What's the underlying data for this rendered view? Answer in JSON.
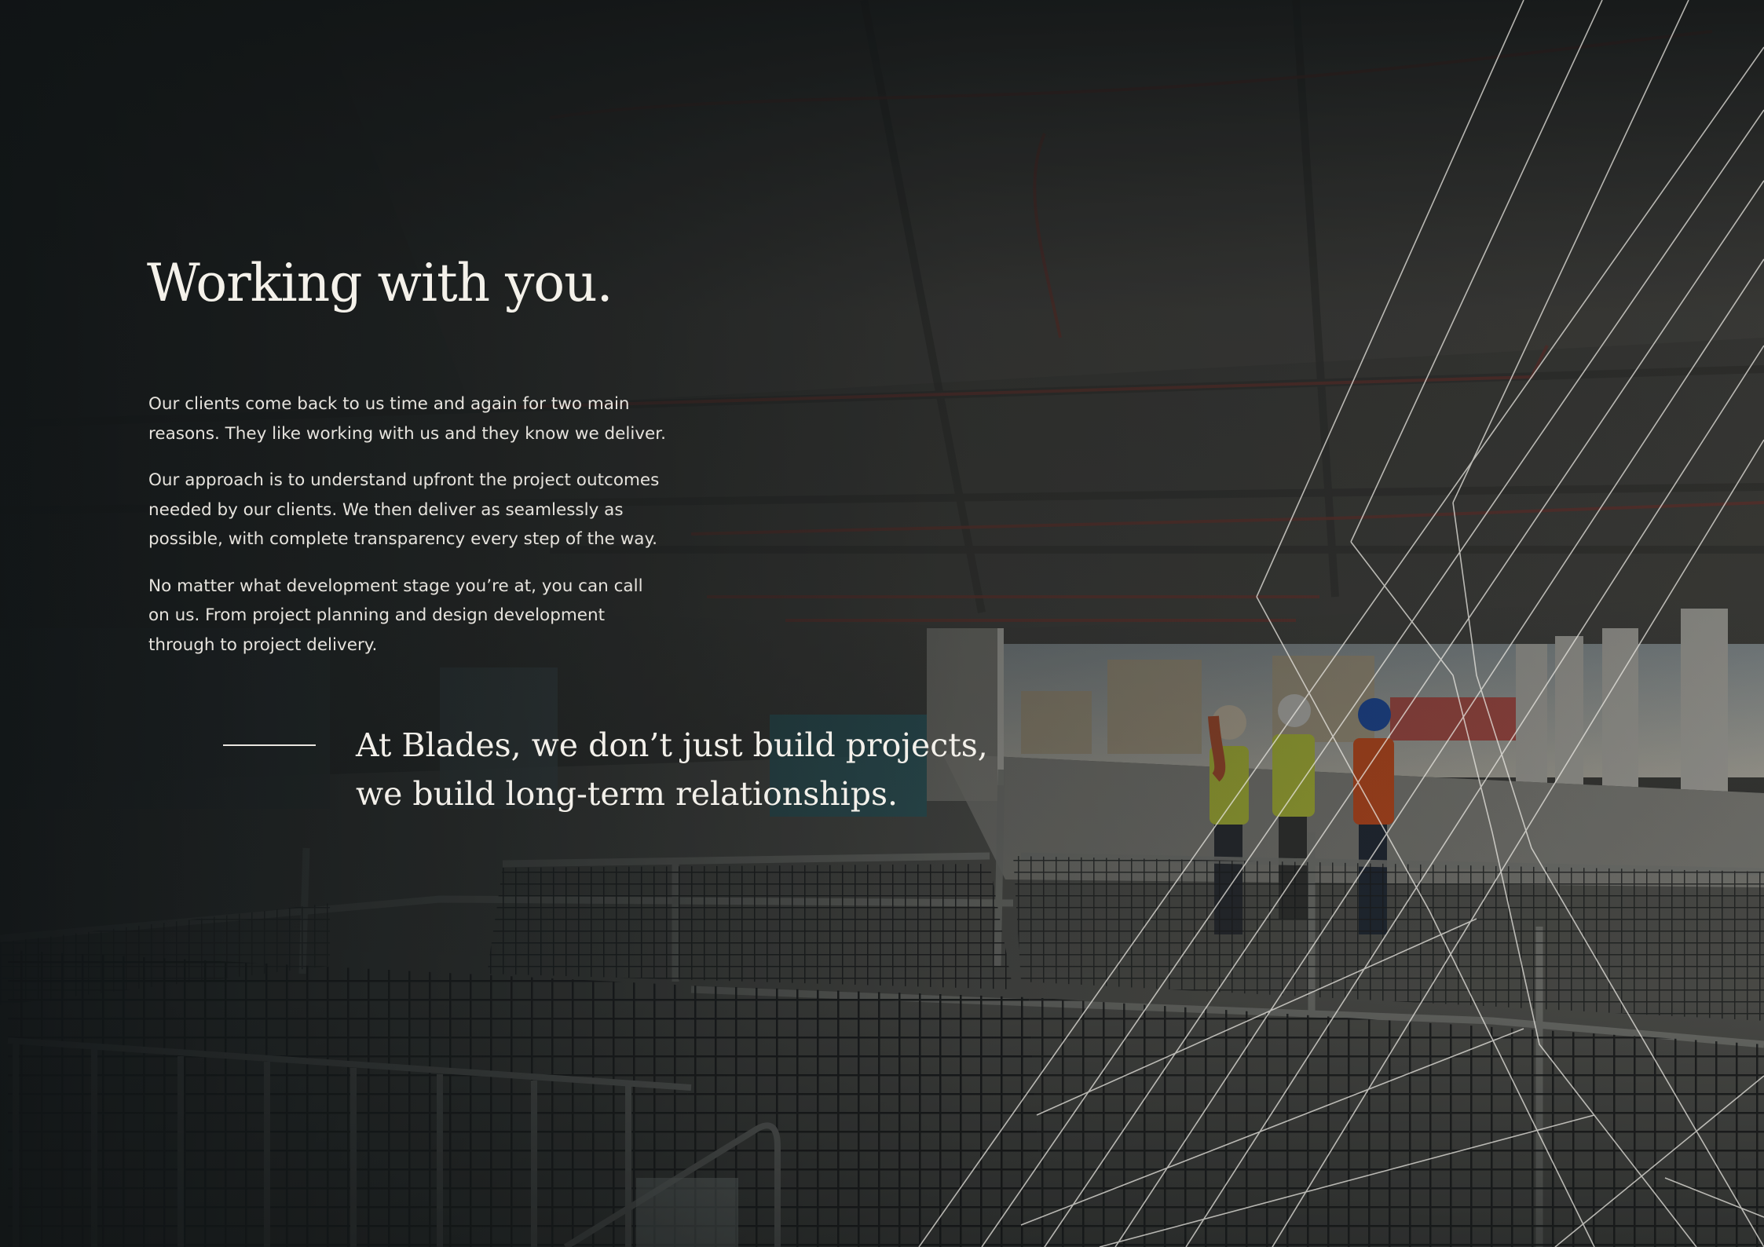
{
  "heading": "Working with you.",
  "paragraphs": [
    {
      "line1": "Our clients come back to us time and again for two main",
      "line2": "reasons. They like working with us and they know we deliver."
    },
    {
      "line1": "Our approach is to understand upfront the project outcomes",
      "line2": "needed by our clients. We then deliver as seamlessly as",
      "line3": "possible, with complete transparency every step of the way."
    },
    {
      "line1": "No matter what development stage you’re at, you can call",
      "line2": "on us. From project planning and design development",
      "line3": "through to project delivery."
    }
  ],
  "quote": {
    "line1": "At Blades, we don’t just build projects,",
    "line2": "we build long-term relationships."
  },
  "colors": {
    "overlay": "#15191b",
    "text": "#f4f1ea",
    "hi_vis_yellow": "#c9d63a",
    "hi_vis_orange": "#e2521c",
    "hard_hat_blue": "#1c4fb0"
  }
}
